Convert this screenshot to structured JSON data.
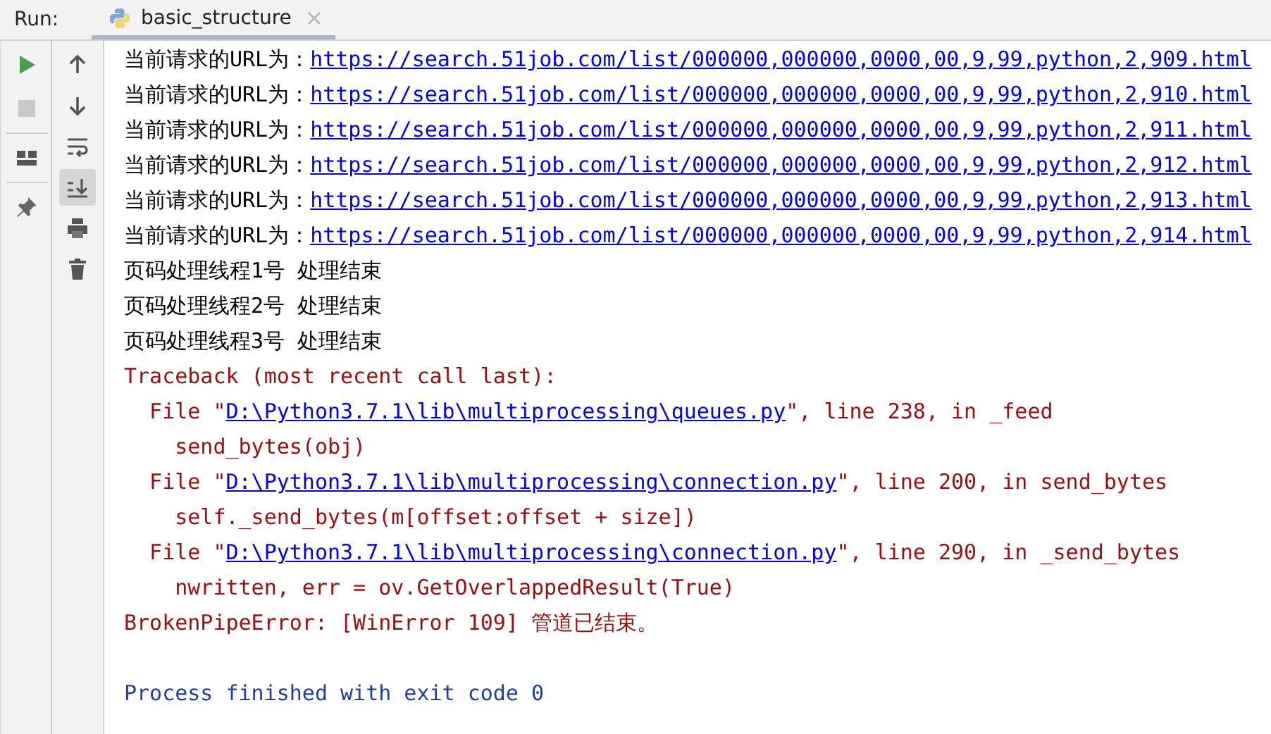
{
  "header": {
    "label": "Run:",
    "tabs": [
      {
        "label": "basic_structure",
        "selected": true
      }
    ]
  },
  "toolbar_1": [
    {
      "kind": "run",
      "disabled": false
    },
    {
      "kind": "stop",
      "disabled": true
    },
    {
      "kind": "layout",
      "disabled": false
    },
    {
      "kind": "pin",
      "disabled": false
    }
  ],
  "toolbar_2": [
    {
      "kind": "up",
      "selected": false
    },
    {
      "kind": "down",
      "selected": false
    },
    {
      "kind": "wrap",
      "selected": false
    },
    {
      "kind": "scroll-end",
      "selected": true
    },
    {
      "kind": "print",
      "selected": false
    },
    {
      "kind": "trash",
      "selected": false
    }
  ],
  "console": [
    {
      "kind": "output",
      "segments": [
        {
          "text": "当前请求的URL为：",
          "link": false
        },
        {
          "text": "https://search.51job.com/list/000000,000000,0000,00,9,99,python,2,909.html",
          "link": true
        }
      ]
    },
    {
      "kind": "output",
      "segments": [
        {
          "text": "当前请求的URL为：",
          "link": false
        },
        {
          "text": "https://search.51job.com/list/000000,000000,0000,00,9,99,python,2,910.html",
          "link": true
        }
      ]
    },
    {
      "kind": "output",
      "segments": [
        {
          "text": "当前请求的URL为：",
          "link": false
        },
        {
          "text": "https://search.51job.com/list/000000,000000,0000,00,9,99,python,2,911.html",
          "link": true
        }
      ]
    },
    {
      "kind": "output",
      "segments": [
        {
          "text": "当前请求的URL为：",
          "link": false
        },
        {
          "text": "https://search.51job.com/list/000000,000000,0000,00,9,99,python,2,912.html",
          "link": true
        }
      ]
    },
    {
      "kind": "output",
      "segments": [
        {
          "text": "当前请求的URL为：",
          "link": false
        },
        {
          "text": "https://search.51job.com/list/000000,000000,0000,00,9,99,python,2,913.html",
          "link": true
        }
      ]
    },
    {
      "kind": "output",
      "segments": [
        {
          "text": "当前请求的URL为：",
          "link": false
        },
        {
          "text": "https://search.51job.com/list/000000,000000,0000,00,9,99,python,2,914.html",
          "link": true
        }
      ]
    },
    {
      "kind": "output",
      "segments": [
        {
          "text": "页码处理线程1号 处理结束",
          "link": false
        }
      ]
    },
    {
      "kind": "output",
      "segments": [
        {
          "text": "页码处理线程2号 处理结束",
          "link": false
        }
      ]
    },
    {
      "kind": "output",
      "segments": [
        {
          "text": "页码处理线程3号 处理结束",
          "link": false
        }
      ]
    },
    {
      "kind": "error",
      "segments": [
        {
          "text": "Traceback (most recent call last):",
          "link": false
        }
      ]
    },
    {
      "kind": "error",
      "segments": [
        {
          "text": "  File \"",
          "link": false
        },
        {
          "text": "D:\\Python3.7.1\\lib\\multiprocessing\\queues.py",
          "link": true
        },
        {
          "text": "\", line 238, in _feed",
          "link": false
        }
      ]
    },
    {
      "kind": "error",
      "segments": [
        {
          "text": "    send_bytes(obj)",
          "link": false
        }
      ]
    },
    {
      "kind": "error",
      "segments": [
        {
          "text": "  File \"",
          "link": false
        },
        {
          "text": "D:\\Python3.7.1\\lib\\multiprocessing\\connection.py",
          "link": true
        },
        {
          "text": "\", line 200, in send_bytes",
          "link": false
        }
      ]
    },
    {
      "kind": "error",
      "segments": [
        {
          "text": "    self._send_bytes(m[offset:offset + size])",
          "link": false
        }
      ]
    },
    {
      "kind": "error",
      "segments": [
        {
          "text": "  File \"",
          "link": false
        },
        {
          "text": "D:\\Python3.7.1\\lib\\multiprocessing\\connection.py",
          "link": true
        },
        {
          "text": "\", line 290, in _send_bytes",
          "link": false
        }
      ]
    },
    {
      "kind": "error",
      "segments": [
        {
          "text": "    nwritten, err = ov.GetOverlappedResult(True)",
          "link": false
        }
      ]
    },
    {
      "kind": "error",
      "segments": [
        {
          "text": "BrokenPipeError: [WinError 109] 管道已结束。",
          "link": false
        }
      ]
    },
    {
      "kind": "blank"
    },
    {
      "kind": "info",
      "segments": [
        {
          "text": "Process finished with exit code 0",
          "link": false
        }
      ]
    }
  ]
}
